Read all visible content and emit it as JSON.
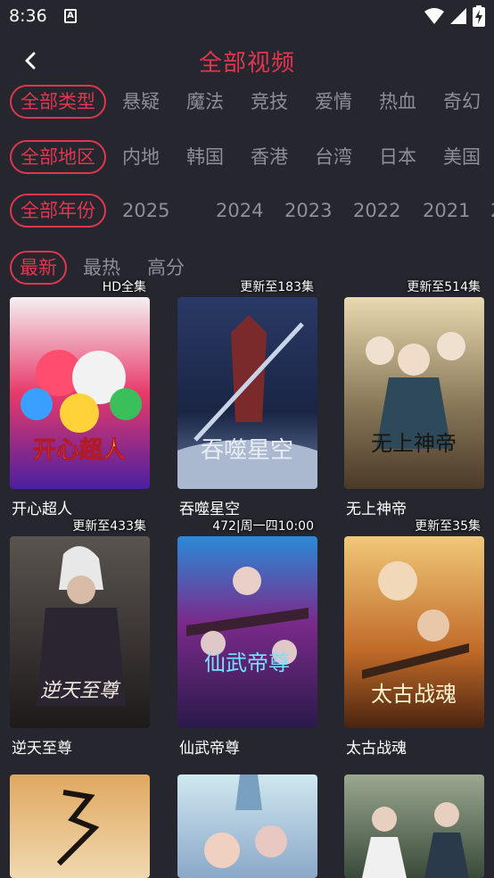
{
  "status_bar": {
    "time": "8:36",
    "notification_glyph": "A"
  },
  "header": {
    "title": "全部视频"
  },
  "filters": {
    "type": {
      "active": "全部类型",
      "options": [
        "悬疑",
        "魔法",
        "竞技",
        "爱情",
        "热血",
        "奇幻"
      ]
    },
    "region": {
      "active": "全部地区",
      "options": [
        "内地",
        "韩国",
        "香港",
        "台湾",
        "日本",
        "美国"
      ]
    },
    "year": {
      "active": "全部年份",
      "options": [
        "2025",
        "2024",
        "2023",
        "2022",
        "2021",
        "2"
      ]
    },
    "sort": {
      "active": "最新",
      "options": [
        "最热",
        "高分"
      ]
    }
  },
  "videos": [
    {
      "title": "开心超人",
      "badge": "HD全集",
      "poster_text": "开心超人"
    },
    {
      "title": "吞噬星空",
      "badge": "更新至183集",
      "poster_text": "吞噬星空"
    },
    {
      "title": "无上神帝",
      "badge": "更新至514集",
      "poster_text": "无上神帝"
    },
    {
      "title": "逆天至尊",
      "badge": "更新至433集",
      "poster_text": "逆天至尊"
    },
    {
      "title": "仙武帝尊",
      "badge": "472|周一四10:00",
      "poster_text": "仙武帝尊"
    },
    {
      "title": "太古战魂",
      "badge": "更新至35集",
      "poster_text": "太古战魂"
    },
    {
      "title": "",
      "badge": "",
      "poster_text": ""
    },
    {
      "title": "",
      "badge": "",
      "poster_text": ""
    },
    {
      "title": "",
      "badge": "",
      "poster_text": ""
    }
  ],
  "colors": {
    "accent": "#e1364f",
    "background": "#25262e",
    "muted_text": "#8e8f96"
  }
}
